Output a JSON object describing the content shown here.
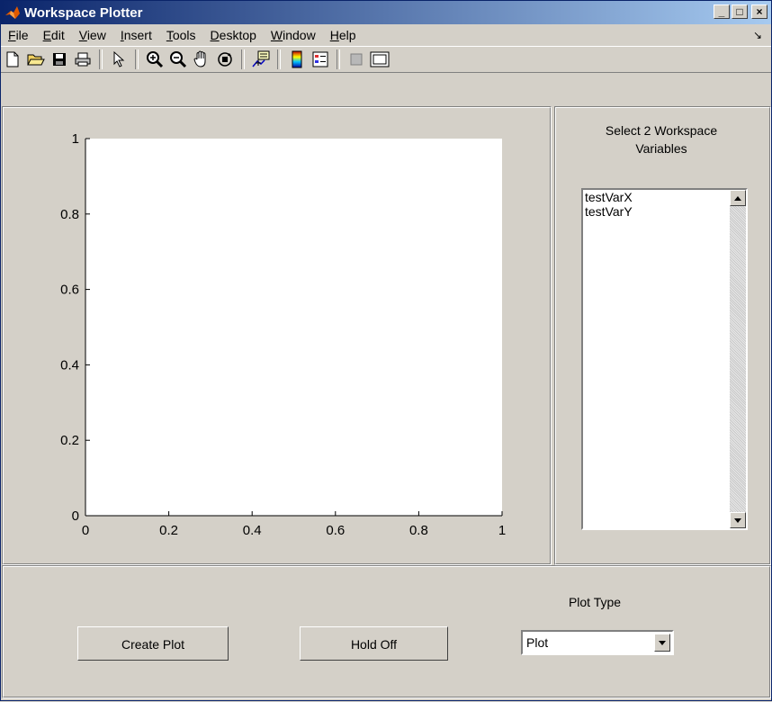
{
  "window": {
    "title": "Workspace Plotter",
    "controls": {
      "minimize": "_",
      "maximize": "□",
      "close": "×"
    }
  },
  "menu": {
    "items": [
      "File",
      "Edit",
      "View",
      "Insert",
      "Tools",
      "Desktop",
      "Window",
      "Help"
    ],
    "dock_arrow": "↘"
  },
  "toolbar": {
    "icons": [
      "new-file-icon",
      "open-folder-icon",
      "save-icon",
      "print-icon",
      "select-arrow-icon",
      "zoom-in-icon",
      "zoom-out-icon",
      "pan-hand-icon",
      "rotate-3d-icon",
      "data-cursor-icon",
      "colorbar-icon",
      "legend-icon",
      "hide-plot-tools-icon",
      "show-plot-tools-icon"
    ]
  },
  "axes": {
    "x_ticks": [
      "0",
      "0.2",
      "0.4",
      "0.6",
      "0.8",
      "1"
    ],
    "y_ticks": [
      "0",
      "0.2",
      "0.4",
      "0.6",
      "0.8",
      "1"
    ]
  },
  "variables": {
    "title_line1": "Select 2 Workspace",
    "title_line2": "Variables",
    "items": [
      "testVarX",
      "testVarY"
    ]
  },
  "controls": {
    "create_plot": "Create Plot",
    "hold_off": "Hold Off",
    "plot_type_label": "Plot Type",
    "plot_type_value": "Plot"
  },
  "colors": {
    "panel_bg": "#d4d0c8",
    "title_gradient_start": "#0a246a",
    "title_gradient_end": "#a6caf0"
  }
}
